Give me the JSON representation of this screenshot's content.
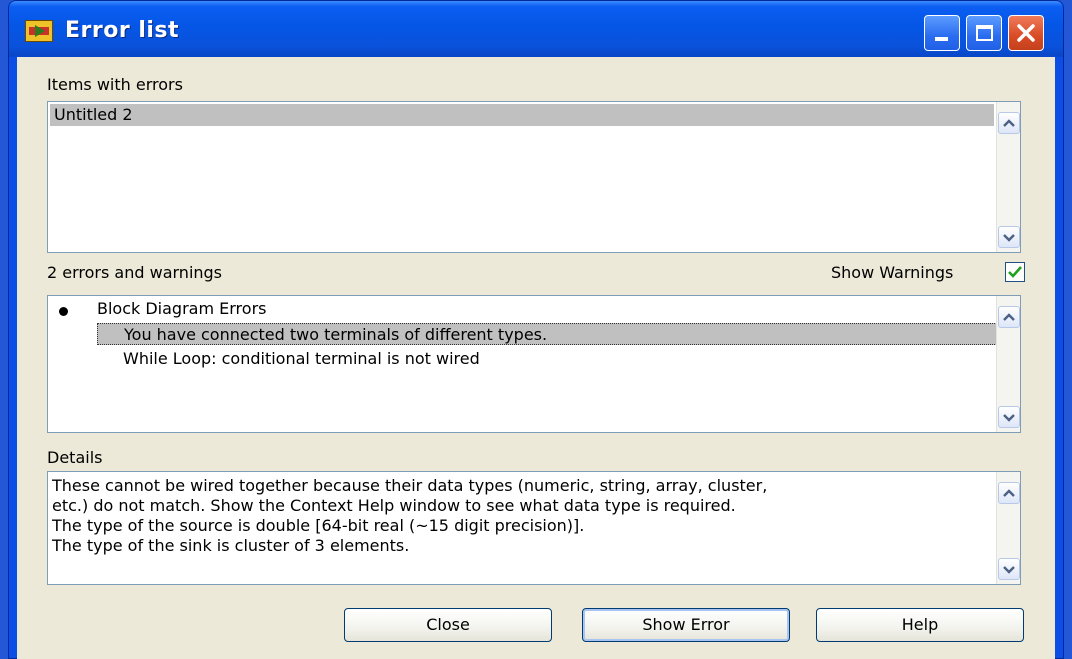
{
  "window": {
    "title": "Error list",
    "icon": "labview-window-icon",
    "controls": [
      "minimize-icon",
      "maximize-icon",
      "close-icon"
    ]
  },
  "items_with_errors": {
    "label": "Items with errors",
    "items": [
      "Untitled 2"
    ],
    "selected_index": 0
  },
  "errors": {
    "count_label": "2 errors and warnings",
    "show_warnings_label": "Show Warnings",
    "show_warnings_checked": true,
    "group": "Block Diagram Errors",
    "items": [
      "You have connected two terminals of different types.",
      "While Loop: conditional terminal is not wired"
    ],
    "selected_index": 0
  },
  "details": {
    "label": "Details",
    "lines": [
      "These cannot be wired together because their data types (numeric, string, array, cluster,",
      "etc.) do not match. Show the Context Help window to see what data type is required.",
      "The type of the source is double [64-bit real (~15 digit precision)].",
      "The type of the sink is cluster of 3 elements."
    ]
  },
  "buttons": {
    "close": "Close",
    "show_error": "Show Error",
    "help": "Help"
  },
  "colors": {
    "titlebar": "#0556e6",
    "face": "#ece9d8",
    "selection": "#c0c0c0",
    "check": "#21a121"
  }
}
